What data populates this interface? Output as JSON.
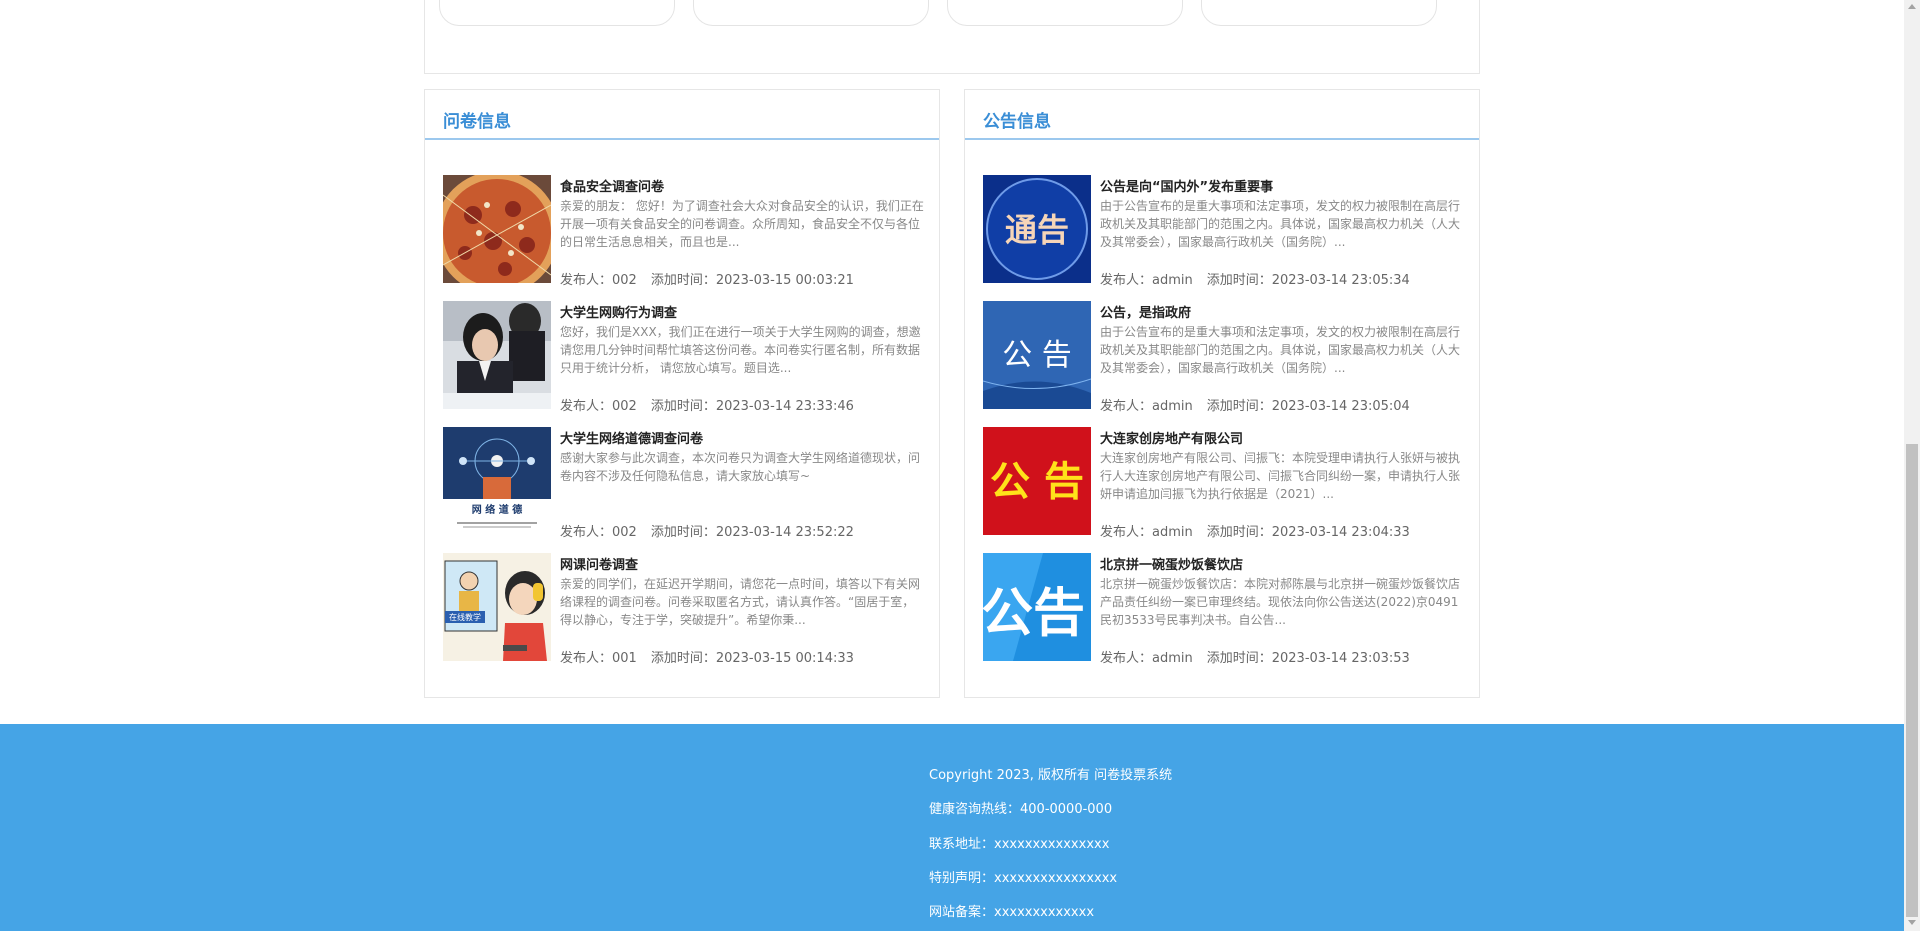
{
  "survey_panel": {
    "title": "问卷信息",
    "items": [
      {
        "title": "食品安全调查问卷",
        "desc": "亲爱的朋友： 您好！为了调查社会大众对食品安全的认识，我们正在开展一项有关食品安全的问卷调查。众所周知，食品安全不仅与各位的日常生活息息相关，而且也是...",
        "publisher": "发布人：002",
        "time": "添加时间：2023-03-15 00:03:21",
        "thumb_icon": "pizza-image"
      },
      {
        "title": "大学生网购行为调查",
        "desc": "您好，我们是XXX，我们正在进行一项关于大学生网购的调查，想邀请您用几分钟时间帮忙填答这份问卷。本问卷实行匿名制，所有数据只用于统计分析， 请您放心填写。题目选...",
        "publisher": "发布人：002",
        "time": "添加时间：2023-03-14 23:33:46",
        "thumb_icon": "student-photo"
      },
      {
        "title": "大学生网络道德调查问卷",
        "desc": "感谢大家参与此次调查，本次问卷只为调查大学生网络道德现状，问卷内容不涉及任何隐私信息，请大家放心填写~",
        "publisher": "发布人：002",
        "time": "添加时间：2023-03-14 23:52:22",
        "thumb_icon": "network-ethics-image",
        "thumb_caption": "网 络 道 德"
      },
      {
        "title": "网课问卷调查",
        "desc": "亲爱的同学们，在延迟开学期间，请您花一点时间，填答以下有关网络课程的调查问卷。问卷采取匿名方式，请认真作答。“固居于室，得以静心，专注于学，突破提升”。希望你秉...",
        "publisher": "发布人：001",
        "time": "添加时间：2023-03-15 00:14:33",
        "thumb_icon": "online-class-cartoon",
        "thumb_caption": "在线教学"
      }
    ]
  },
  "notice_panel": {
    "title": "公告信息",
    "items": [
      {
        "title": "公告是向“国内外”发布重要事",
        "desc": "由于公告宣布的是重大事项和法定事项，发文的权力被限制在高层行政机关及其职能部门的范围之内。具体说，国家最高权力机关（人大及其常委会），国家最高行政机关（国务院）...",
        "publisher": "发布人：admin",
        "time": "添加时间：2023-03-14 23:05:34",
        "thumb_icon": "notice-badge-image",
        "thumb_text": "通告"
      },
      {
        "title": "公告，是指政府",
        "desc": "由于公告宣布的是重大事项和法定事项，发文的权力被限制在高层行政机关及其职能部门的范围之内。具体说，国家最高权力机关（人大及其常委会），国家最高行政机关（国务院）...",
        "publisher": "发布人：admin",
        "time": "添加时间：2023-03-14 23:05:04",
        "thumb_icon": "notice-blue-image",
        "thumb_text": "公 告"
      },
      {
        "title": "大连家创房地产有限公司",
        "desc": "大连家创房地产有限公司、闫振飞：本院受理申请执行人张妍与被执行人大连家创房地产有限公司、闫振飞合同纠纷一案，申请执行人张妍申请追加闫振飞为执行依据是（2021）...",
        "publisher": "发布人：admin",
        "time": "添加时间：2023-03-14 23:04:33",
        "thumb_icon": "notice-red-image",
        "thumb_text": "公 告"
      },
      {
        "title": "北京拼一碗蛋炒饭餐饮店",
        "desc": "北京拼一碗蛋炒饭餐饮店：本院对郝陈晨与北京拼一碗蛋炒饭餐饮店产品责任纠纷一案已审理终结。现依法向你公告送达(2022)京0491民初3533号民事判决书。自公告...",
        "publisher": "发布人：admin",
        "time": "添加时间：2023-03-14 23:03:53",
        "thumb_icon": "notice-cyan-image",
        "thumb_text": "公告"
      }
    ]
  },
  "footer": {
    "copyright": "Copyright 2023, 版权所有 问卷投票系统",
    "hotline": "健康咨询热线：400-0000-000",
    "address": "联系地址：xxxxxxxxxxxxxxx",
    "statement": "特别声明：xxxxxxxxxxxxxxxx",
    "icp": "网站备案：xxxxxxxxxxxxx"
  },
  "colors": {
    "accent": "#3a8ed6",
    "footer_bg": "#45a4e6"
  }
}
